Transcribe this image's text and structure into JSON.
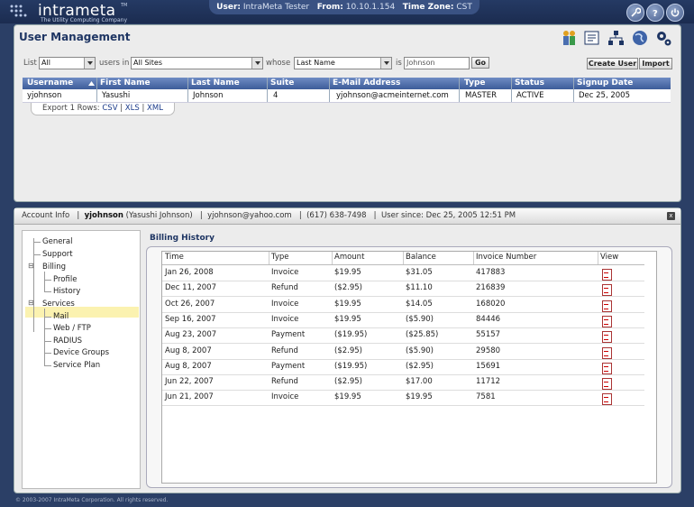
{
  "brand": {
    "name": "intrameta",
    "tagline": "The Utility Computing Company",
    "tm": "TM"
  },
  "session": {
    "user_label": "User:",
    "user": "IntraMeta Tester",
    "from_label": "From:",
    "from": "10.10.1.154",
    "tz_label": "Time Zone:",
    "tz": "CST"
  },
  "top_icons": [
    "wrench-icon",
    "help-icon",
    "power-icon"
  ],
  "page": {
    "title": "User Management"
  },
  "header_icons": [
    "users-icon",
    "billing-icon",
    "network-icon",
    "globe-icon",
    "settings-icon"
  ],
  "filter": {
    "list_label": "List",
    "list_value": "All",
    "users_in_label": "users in",
    "site_value": "All Sites",
    "whose_label": "whose",
    "field_value": "Last Name",
    "is_label": "is",
    "query_value": "Johnson",
    "go_label": "Go",
    "create_user_label": "Create User",
    "import_label": "Import"
  },
  "users_table": {
    "columns": [
      "Username",
      "First Name",
      "Last Name",
      "Suite",
      "E-Mail Address",
      "Type",
      "Status",
      "Signup Date"
    ],
    "rows": [
      [
        "yjohnson",
        "Yasushi",
        "Johnson",
        "4",
        "yjohnson@acmeinternet.com",
        "MASTER",
        "ACTIVE",
        "Dec 25, 2005"
      ]
    ]
  },
  "export": {
    "prefix": "Export 1 Rows:",
    "csv": "CSV",
    "xls": "XLS",
    "xml": "XML",
    "sep": "|"
  },
  "account_bar": {
    "section": "Account Info",
    "username": "yjohnson",
    "fullname": "(Yasushi Johnson)",
    "email": "yjohnson@yahoo.com",
    "phone": "(617) 638-7498",
    "since": "User since: Dec 25, 2005 12:51 PM",
    "close": "x"
  },
  "tree": {
    "general": "General",
    "support": "Support",
    "billing": "Billing",
    "profile": "Profile",
    "history": "History",
    "services": "Services",
    "mail": "Mail",
    "webftp": "Web / FTP",
    "radius": "RADIUS",
    "device_groups": "Device Groups",
    "service_plan": "Service Plan",
    "expand_symbol": "⊟"
  },
  "billing": {
    "title": "Billing History",
    "columns": [
      "Time",
      "Type",
      "Amount",
      "Balance",
      "Invoice Number",
      "View"
    ],
    "rows": [
      [
        "Jan 26, 2008",
        "Invoice",
        "$19.95",
        "$31.05",
        "417883"
      ],
      [
        "Dec 11, 2007",
        "Refund",
        "($2.95)",
        "$11.10",
        "216839"
      ],
      [
        "Oct 26, 2007",
        "Invoice",
        "$19.95",
        "$14.05",
        "168020"
      ],
      [
        "Sep 16, 2007",
        "Invoice",
        "$19.95",
        "($5.90)",
        "84446"
      ],
      [
        "Aug 23, 2007",
        "Payment",
        "($19.95)",
        "($25.85)",
        "55157"
      ],
      [
        "Aug 8, 2007",
        "Refund",
        "($2.95)",
        "($5.90)",
        "29580"
      ],
      [
        "Aug 8, 2007",
        "Payment",
        "($19.95)",
        "($2.95)",
        "15691"
      ],
      [
        "Jun 22, 2007",
        "Refund",
        "($2.95)",
        "$17.00",
        "11712"
      ],
      [
        "Jun 21, 2007",
        "Invoice",
        "$19.95",
        "$19.95",
        "7581"
      ]
    ],
    "view_icon": "pdf-icon"
  },
  "footer": {
    "copyright": "© 2003-2007 IntraMeta Corporation.  All rights reserved."
  },
  "colors": {
    "accent": "#1e3563",
    "header_blue": "#3d5c99",
    "background": "#2b3f66",
    "selection": "#fbf2b0"
  }
}
